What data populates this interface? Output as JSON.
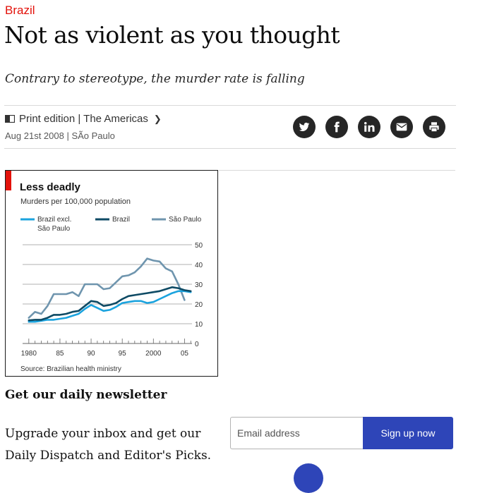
{
  "article": {
    "kicker": "Brazil",
    "headline": "Not as violent as you thought",
    "subheadline": "Contrary to stereotype, the murder rate is falling",
    "section_link": "Print edition | The Americas",
    "dateline": "Aug 21st 2008 | SÃo Paulo",
    "share_icons": [
      "twitter-icon",
      "facebook-icon",
      "linkedin-icon",
      "mail-icon",
      "print-icon"
    ]
  },
  "newsletter": {
    "title": "Get our daily newsletter",
    "body": "Upgrade your inbox and get our Daily Dispatch and Editor's Picks.",
    "email_placeholder": "Email address",
    "button_label": "Sign up now"
  },
  "colors": {
    "kicker": "#e3120b",
    "signup_button": "#2e45b8",
    "share_icon_bg": "#262626"
  },
  "chart_data": {
    "type": "line",
    "title": "Less deadly",
    "subtitle": "Murders per 100,000 population",
    "source": "Source: Brazilian health ministry",
    "x_tick_labels": [
      "1980",
      "85",
      "90",
      "95",
      "2000",
      "05"
    ],
    "x_ticks": [
      1980,
      1985,
      1990,
      1995,
      2000,
      2005
    ],
    "y_tick_labels": [
      "0",
      "10",
      "20",
      "30",
      "40",
      "50"
    ],
    "y_ticks": [
      0,
      10,
      20,
      30,
      40,
      50
    ],
    "xlim": [
      1979,
      2006.2
    ],
    "ylim": [
      0,
      50
    ],
    "legend_position": "top",
    "colors": {
      "accent": "#e3120b"
    },
    "x": [
      1980,
      1981,
      1982,
      1983,
      1984,
      1985,
      1986,
      1987,
      1988,
      1989,
      1990,
      1991,
      1992,
      1993,
      1994,
      1995,
      1996,
      1997,
      1998,
      1999,
      2000,
      2001,
      2002,
      2003,
      2004,
      2005,
      2006
    ],
    "series": [
      {
        "name": "Brazil excl. São Paulo",
        "color": "#1ba3de",
        "values": [
          11,
          11,
          11.5,
          12,
          12,
          12.5,
          13,
          14,
          15,
          17.5,
          19.5,
          18,
          16.5,
          17,
          18.5,
          20.5,
          21,
          21.5,
          21.5,
          20.5,
          21,
          22.5,
          24,
          25.5,
          26.5,
          26.5,
          26
        ]
      },
      {
        "name": "Brazil",
        "color": "#0e4a64",
        "values": [
          11.7,
          12,
          12,
          13,
          14.5,
          14.5,
          15,
          16,
          16.5,
          19,
          21.5,
          21,
          19,
          19.5,
          20.5,
          22.5,
          24,
          24.5,
          25,
          25.5,
          26,
          26.5,
          27.5,
          28.5,
          28,
          27,
          26.5
        ]
      },
      {
        "name": "São Paulo",
        "color": "#6f95ae",
        "values": [
          13,
          16,
          15,
          19,
          25,
          25,
          25,
          26,
          24,
          30,
          30,
          30,
          27.5,
          28,
          31,
          34,
          34.5,
          36,
          39,
          43,
          42,
          41.5,
          38,
          36.5,
          30,
          22
        ]
      }
    ]
  }
}
